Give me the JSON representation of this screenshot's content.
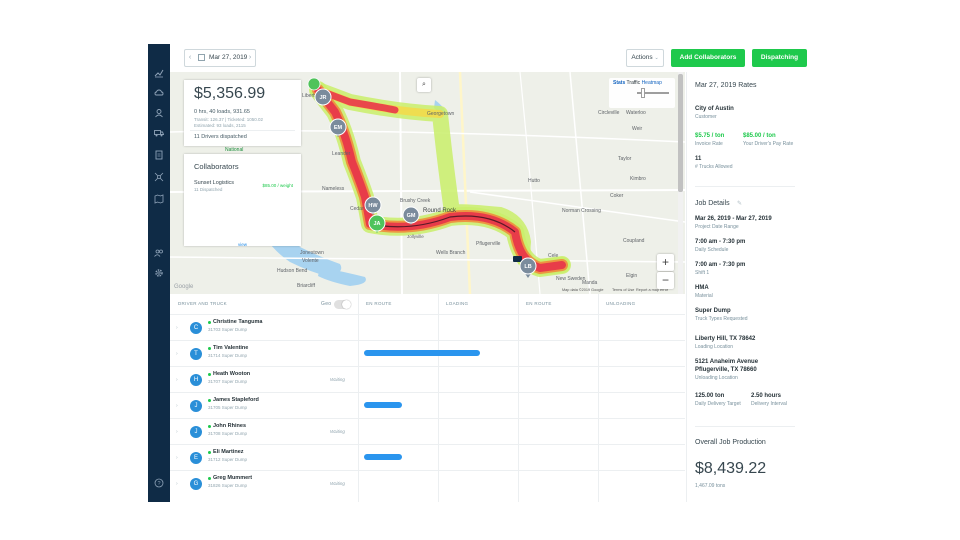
{
  "topbar": {
    "date": "Mar 27, 2019",
    "actions_label": "Actions",
    "add_collaborators_label": "Add Collaborators",
    "dispatching_label": "Dispatching"
  },
  "stats": {
    "revenue": "$5,356.99",
    "summary": "0 hrs, 40 loads, 931.65",
    "transit": "Transit: 126.37 | Ticketed: 1050.02",
    "estimated": "Estimated: 93 loads, 2115",
    "drivers_dispatched": "11 Drivers dispatched"
  },
  "collaborators": {
    "title": "Collaborators",
    "company": "Sunset Logistics",
    "dispatched": "11 Dispatched",
    "rate": "$85.00 / weight",
    "view_label": "view"
  },
  "map": {
    "labels": [
      "Georgetown",
      "Leander",
      "Cedar Park",
      "Brushy Creek",
      "Round Rock",
      "Pflugerville",
      "Hutto",
      "Taylor",
      "Circleville",
      "Waterloo",
      "Norman Crossing",
      "Coupland",
      "Manda",
      "New Sweden",
      "Elgin",
      "Jonestown",
      "Hudson Bend",
      "Volente",
      "Briarcliff",
      "Jollyville",
      "Wells Branch",
      "Cele",
      "Liberty Hill",
      "Kimbro",
      "Weir",
      "Nameless",
      "Coker"
    ],
    "map_attribution": "Map data ©2019 Google",
    "terms": "Terms of Use",
    "report": "Report a map error",
    "toggle_stats": "Stats",
    "toggle_traffic": "Traffic",
    "toggle_heatmap": "Heatmap",
    "markers": [
      "JR",
      "EM",
      "HW",
      "JA",
      "GM",
      "LB"
    ],
    "national_label": "National",
    "google_label": "Google"
  },
  "table": {
    "columns": [
      "DRIVER AND TRUCK",
      "EN ROUTE",
      "LOADING",
      "EN ROUTE",
      "UNLOADING"
    ],
    "geo_label": "Geo",
    "rows": [
      {
        "initial": "C",
        "name": "Christine Tanguma",
        "truck": "31703 Super Dump",
        "status": "",
        "bar": 0
      },
      {
        "initial": "T",
        "name": "Tim Valentine",
        "truck": "31714 Super Dump",
        "status": "",
        "bar": 1.55
      },
      {
        "initial": "H",
        "name": "Heath Wooton",
        "truck": "31707 Super Dump",
        "status": "Waiting",
        "bar": 0
      },
      {
        "initial": "J",
        "name": "James Stapleford",
        "truck": "31705 Super Dump",
        "status": "",
        "bar": 0.5
      },
      {
        "initial": "J",
        "name": "John Rhines",
        "truck": "31708 Super Dump",
        "status": "Waiting",
        "bar": 0
      },
      {
        "initial": "E",
        "name": "Eli Martinez",
        "truck": "31712 Super Dump",
        "status": "",
        "bar": 0.5
      },
      {
        "initial": "G",
        "name": "Greg Mummert",
        "truck": "31826 Super Dump",
        "status": "Waiting",
        "bar": 0
      }
    ]
  },
  "rates": {
    "title": "Mar 27, 2019 Rates",
    "customer_name": "City of Austin",
    "customer_label": "Customer",
    "invoice_rate": "$5.75 / ton",
    "invoice_rate_label": "Invoice Rate",
    "driver_pay": "$85.00 / ton",
    "driver_pay_label": "Your Driver's Pay Rate",
    "trucks": "11",
    "trucks_label": "# Trucks Allowed"
  },
  "job": {
    "title": "Job Details",
    "date_range": "Mar 26, 2019 - Mar 27, 2019",
    "date_range_label": "Project Date Range",
    "daily_schedule": "7:00 am - 7:30 pm",
    "daily_schedule_label": "Daily Schedule",
    "shift": "7:00 am - 7:30 pm",
    "shift_label": "Shift 1",
    "material": "HMA",
    "material_label": "Material",
    "truck_type": "Super Dump",
    "truck_type_label": "Truck Types Requested",
    "loading": "Liberty Hill, TX 78642",
    "loading_label": "Loading Location",
    "unloading_1": "5121 Anaheim Avenue",
    "unloading_2": "Pflugerville, TX 78660",
    "unloading_label": "Unloading Location",
    "target": "125.00 ton",
    "target_label": "Daily Delivery Target",
    "interval": "2.50 hours",
    "interval_label": "Delivery Interval"
  },
  "production": {
    "title": "Overall Job Production",
    "amount": "$8,439.22",
    "tons": "1,467.09 tons"
  }
}
